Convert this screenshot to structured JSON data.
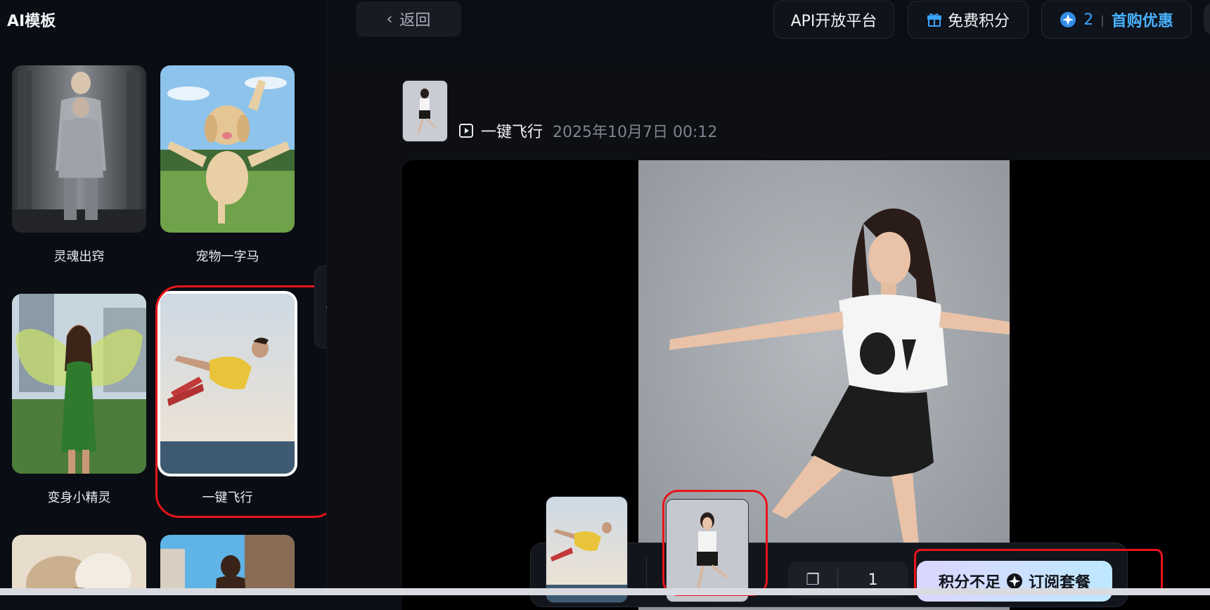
{
  "sidebar": {
    "title": "AI模板",
    "cards": [
      {
        "label": "灵魂出窍"
      },
      {
        "label": "宠物一字马"
      },
      {
        "label": "变身小精灵"
      },
      {
        "label": "一键飞行"
      },
      {
        "label": ""
      },
      {
        "label": ""
      }
    ],
    "collapse_icon": "chevron-left-icon"
  },
  "topbar": {
    "back_label": "返回",
    "api_label": "API开放平台",
    "credits_label": "免费积分",
    "promo_count": "2",
    "promo_label": "首购优惠"
  },
  "task": {
    "name": "一键飞行",
    "time": "2025年10月7日 00:12"
  },
  "tray": {
    "count": "1",
    "subscribe_prefix": "积分不足",
    "subscribe_label": "订阅套餐"
  },
  "colors": {
    "accent": "#3aa3ff",
    "highlight": "#e8141b"
  }
}
